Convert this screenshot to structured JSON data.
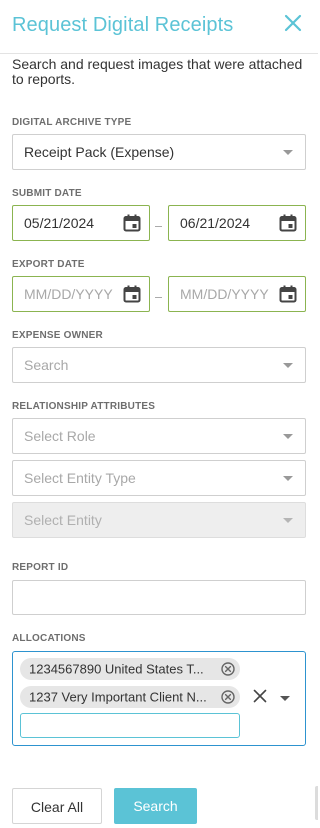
{
  "panel": {
    "title": "Request Digital Receipts",
    "description": "Search and request images that were attached to reports."
  },
  "archive_type": {
    "label": "DIGITAL ARCHIVE TYPE",
    "value": "Receipt Pack (Expense)"
  },
  "submit_date": {
    "label": "SUBMIT DATE",
    "from": "05/21/2024",
    "to": "06/21/2024"
  },
  "export_date": {
    "label": "EXPORT DATE",
    "from_placeholder": "MM/DD/YYYY",
    "to_placeholder": "MM/DD/YYYY"
  },
  "expense_owner": {
    "label": "EXPENSE OWNER",
    "placeholder": "Search"
  },
  "relationship": {
    "label": "RELATIONSHIP ATTRIBUTES",
    "role_placeholder": "Select Role",
    "entity_type_placeholder": "Select Entity Type",
    "entity_placeholder": "Select Entity"
  },
  "report_id": {
    "label": "REPORT ID",
    "value": ""
  },
  "allocations": {
    "label": "ALLOCATIONS",
    "chips": [
      "1234567890 United States T...",
      "1237 Very Important Client N..."
    ],
    "input_value": ""
  },
  "buttons": {
    "clear_all": "Clear All",
    "search": "Search"
  },
  "colors": {
    "accent": "#5bc3d6",
    "valid_border": "#8bb450",
    "focus_border": "#2d93cf"
  },
  "icons": {
    "close": "close-icon",
    "calendar": "calendar-icon",
    "dropdown": "chevron-down-icon",
    "chip_remove": "remove-chip-icon",
    "clear_all_allocations": "clear-icon"
  }
}
